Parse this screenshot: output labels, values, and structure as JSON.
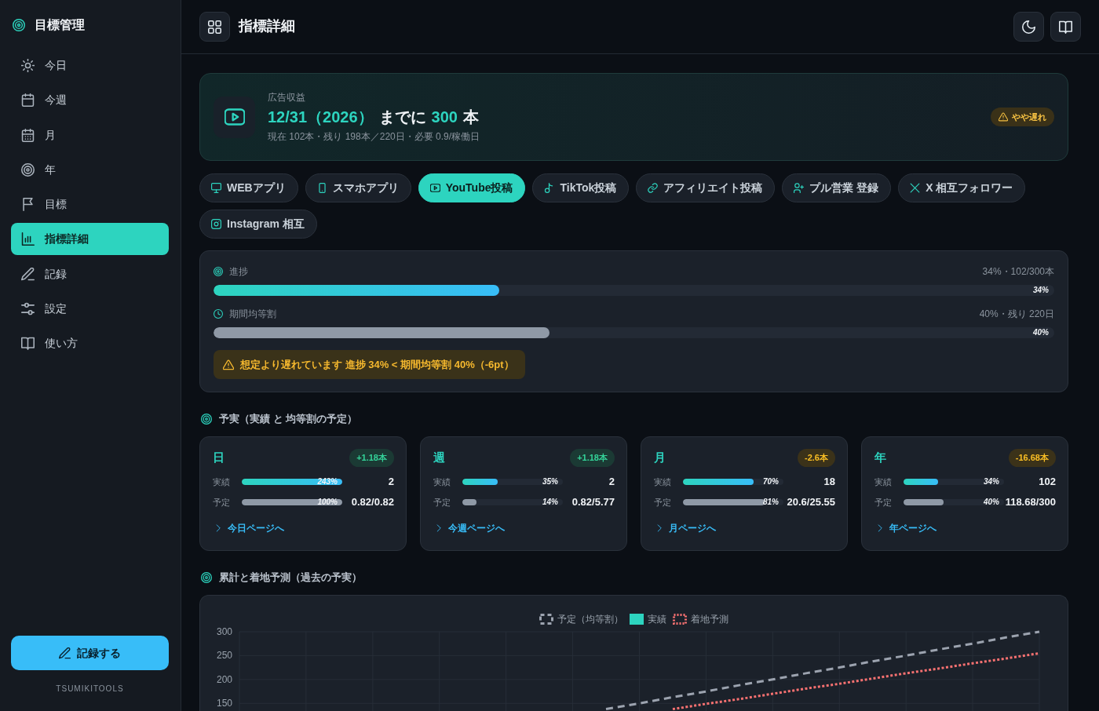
{
  "sidebar": {
    "brand": "目標管理",
    "items": [
      {
        "label": "今日",
        "selected": false
      },
      {
        "label": "今週",
        "selected": false
      },
      {
        "label": "月",
        "selected": false
      },
      {
        "label": "年",
        "selected": false
      },
      {
        "label": "目標",
        "selected": false
      },
      {
        "label": "指標詳細",
        "selected": true
      },
      {
        "label": "記録",
        "selected": false
      },
      {
        "label": "設定",
        "selected": false
      },
      {
        "label": "使い方",
        "selected": false
      }
    ],
    "record_button": "記録する",
    "footer": "TSUMIKITOOLS"
  },
  "header": {
    "title": "指標詳細"
  },
  "goal": {
    "category": "広告収益",
    "headline": [
      {
        "text": "12/31（2026）",
        "highlight": true
      },
      {
        "text": "までに",
        "highlight": false
      },
      {
        "text": "300",
        "highlight": true
      },
      {
        "text": "本",
        "highlight": false
      }
    ],
    "summary": "現在 102本・残り 198本／220日・必要 0.9/稼働日",
    "status": {
      "label": "やや遅れ",
      "kind": "warning"
    }
  },
  "metric_tabs": [
    {
      "label": "WEBアプリ",
      "selected": false
    },
    {
      "label": "スマホアプリ",
      "selected": false
    },
    {
      "label": "YouTube投稿",
      "selected": true
    },
    {
      "label": "TikTok投稿",
      "selected": false
    },
    {
      "label": "アフィリエイト投稿",
      "selected": false
    },
    {
      "label": "プル営業 登録",
      "selected": false
    },
    {
      "label": "X 相互フォロワー",
      "selected": false
    },
    {
      "label": "Instagram 相互",
      "selected": false
    }
  ],
  "progress": {
    "rows": [
      {
        "kind": "actual",
        "label": "進捗",
        "reading": "34%・102/300本",
        "level": 0.34,
        "bar_label": "34%"
      },
      {
        "kind": "plan",
        "label": "期間均等割",
        "reading": "40%・残り 220日",
        "level": 0.4,
        "bar_label": "40%"
      }
    ],
    "alert": "想定より遅れています 進捗 34% < 期間均等割 40%（-6pt）"
  },
  "plan_vs_actual": {
    "title": "予実（実績 と 均等割の予定）",
    "periods": [
      {
        "name": "日",
        "delta": {
          "text": "+1.18本",
          "kind": "ahead"
        },
        "rows": [
          {
            "kind": "actual",
            "label": "実績",
            "level": 1,
            "percent": "243%",
            "value": "2"
          },
          {
            "kind": "plan",
            "label": "予定",
            "level": 1,
            "percent": "100%",
            "value": "0.82/0.82"
          }
        ],
        "link": "今日ページへ"
      },
      {
        "name": "週",
        "delta": {
          "text": "+1.18本",
          "kind": "ahead"
        },
        "rows": [
          {
            "kind": "actual",
            "label": "実績",
            "level": 0.35,
            "percent": "35%",
            "value": "2"
          },
          {
            "kind": "plan",
            "label": "予定",
            "level": 0.14,
            "percent": "14%",
            "value": "0.82/5.77"
          }
        ],
        "link": "今週ページへ"
      },
      {
        "name": "月",
        "delta": {
          "text": "-2.6本",
          "kind": "behind"
        },
        "rows": [
          {
            "kind": "actual",
            "label": "実績",
            "level": 0.7,
            "percent": "70%",
            "value": "18"
          },
          {
            "kind": "plan",
            "label": "予定",
            "level": 0.81,
            "percent": "81%",
            "value": "20.6/25.55"
          }
        ],
        "link": "月ページへ"
      },
      {
        "name": "年",
        "delta": {
          "text": "-16.68本",
          "kind": "behind"
        },
        "rows": [
          {
            "kind": "actual",
            "label": "実績",
            "level": 0.34,
            "percent": "34%",
            "value": "102"
          },
          {
            "kind": "plan",
            "label": "予定",
            "level": 0.4,
            "percent": "40%",
            "value": "118.68/300"
          }
        ],
        "link": "年ページへ"
      }
    ]
  },
  "forecast": {
    "title": "累計と着地予測（過去の予実）",
    "chart_data": {
      "type": "line",
      "grid": true,
      "categories": [
        null,
        null,
        null,
        null,
        null,
        null,
        null,
        null,
        null,
        null,
        null,
        null,
        null,
        null,
        null,
        null,
        null,
        null,
        null,
        null,
        null,
        null,
        null,
        null,
        null
      ],
      "ylim": [
        134,
        300
      ],
      "yticks": [
        150,
        200,
        250,
        300
      ],
      "series": [
        {
          "name": "予定（均等割）",
          "color": "#9ca3af",
          "line_style": "dashed",
          "values": [
            null,
            null,
            null,
            null,
            null,
            null,
            null,
            null,
            null,
            null,
            null,
            138,
            150,
            163,
            175,
            188,
            200,
            213,
            225,
            238,
            250,
            263,
            275,
            288,
            300
          ]
        },
        {
          "name": "実績",
          "color": "#2dd4bf",
          "values": [
            null,
            null,
            null,
            null,
            null,
            null,
            null,
            null,
            null,
            null,
            null,
            null,
            null,
            null,
            null,
            null,
            null,
            null,
            null,
            null,
            null,
            null,
            null,
            null,
            null
          ]
        },
        {
          "name": "着地予測",
          "color": "#f87171",
          "line_style": "dotted",
          "values": [
            null,
            null,
            null,
            null,
            null,
            null,
            null,
            null,
            null,
            null,
            null,
            null,
            null,
            138,
            149,
            159,
            170,
            181,
            191,
            202,
            213,
            223,
            234,
            244,
            255
          ]
        }
      ]
    }
  }
}
